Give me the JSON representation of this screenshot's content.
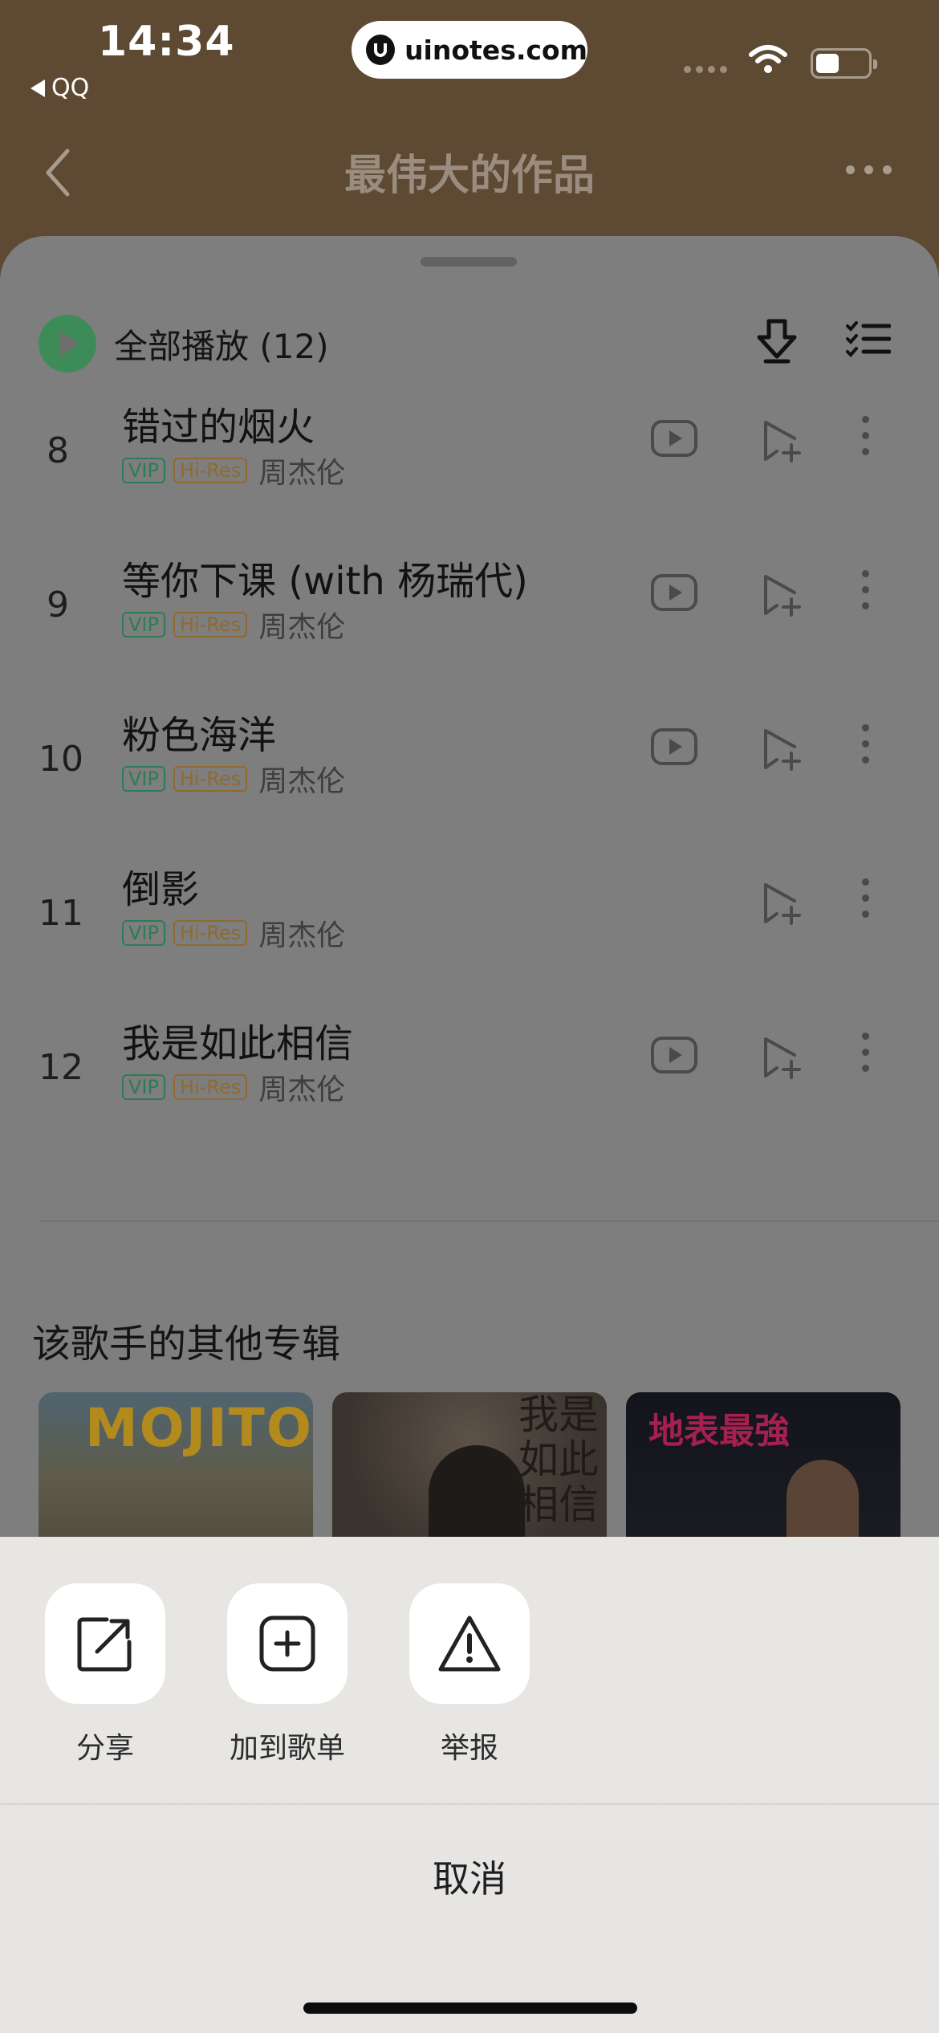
{
  "status_bar": {
    "time": "14:34",
    "back_app": "QQ",
    "url": "uinotes.com"
  },
  "nav": {
    "title": "最伟大的作品"
  },
  "toolbar": {
    "play_all_label": "全部播放",
    "play_all_count": "(12)",
    "download_icon": "download-icon",
    "select_icon": "multi-select-icon"
  },
  "songs": [
    {
      "num": "8",
      "title": "错过的烟火",
      "tag_vip": "VIP",
      "tag_hires": "Hi-Res",
      "artist": "周杰伦",
      "has_mv": true
    },
    {
      "num": "9",
      "title": "等你下课 (with 杨瑞代)",
      "tag_vip": "VIP",
      "tag_hires": "Hi-Res",
      "artist": "周杰伦",
      "has_mv": true
    },
    {
      "num": "10",
      "title": "粉色海洋",
      "tag_vip": "VIP",
      "tag_hires": "Hi-Res",
      "artist": "周杰伦",
      "has_mv": true
    },
    {
      "num": "11",
      "title": "倒影",
      "tag_vip": "VIP",
      "tag_hires": "Hi-Res",
      "artist": "周杰伦",
      "has_mv": false
    },
    {
      "num": "12",
      "title": "我是如此相信",
      "tag_vip": "VIP",
      "tag_hires": "Hi-Res",
      "artist": "周杰伦",
      "has_mv": true
    }
  ],
  "other_albums": {
    "title": "该歌手的其他专辑",
    "albums": [
      {
        "cover_text": "MOJITO"
      },
      {
        "cover_text": "我是如此相信"
      },
      {
        "cover_text": "地表最強"
      }
    ]
  },
  "action_sheet": {
    "actions": [
      {
        "label": "分享",
        "icon": "share-icon"
      },
      {
        "label": "加到歌单",
        "icon": "add-to-playlist-icon"
      },
      {
        "label": "举报",
        "icon": "report-icon"
      }
    ],
    "cancel_label": "取消"
  },
  "colors": {
    "header_brown": "#5e4a33",
    "sheet_dimmed": "#7e7e7e",
    "play_green": "#3d8c58",
    "vip_green": "#2d7b57",
    "hires_gold": "#8f6a2f",
    "action_bg": "#e8e6e3"
  }
}
